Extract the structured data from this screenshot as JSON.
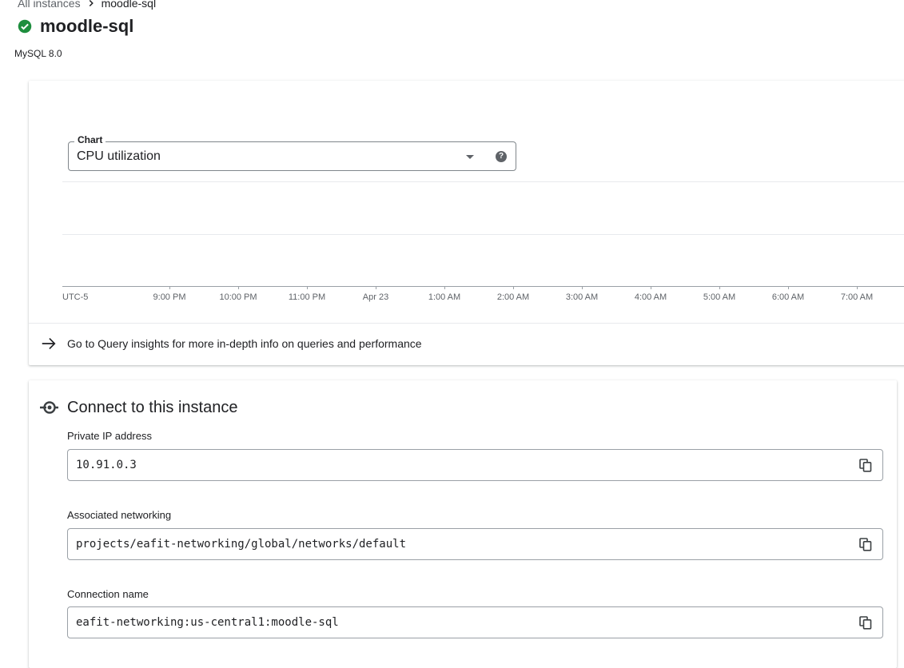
{
  "breadcrumb": {
    "root": "All instances",
    "current": "moodle-sql"
  },
  "instance": {
    "name": "moodle-sql",
    "status": "running",
    "version": "MySQL 8.0"
  },
  "chart_panel": {
    "select_legend": "Chart",
    "selected_metric": "CPU utilization",
    "timezone": "UTC-5",
    "time_ticks": [
      "9:00 PM",
      "10:00 PM",
      "11:00 PM",
      "Apr 23",
      "1:00 AM",
      "2:00 AM",
      "3:00 AM",
      "4:00 AM",
      "5:00 AM",
      "6:00 AM",
      "7:00 AM"
    ],
    "insights_link": "Go to Query insights for more in-depth info on queries and performance"
  },
  "connect": {
    "title": "Connect to this instance",
    "fields": [
      {
        "label": "Private IP address",
        "value": "10.91.0.3"
      },
      {
        "label": "Associated networking",
        "value": "projects/eafit-networking/global/networks/default"
      },
      {
        "label": "Connection name",
        "value": "eafit-networking:us-central1:moodle-sql"
      }
    ]
  },
  "colors": {
    "status_ok": "#1e8e3e",
    "icon": "#5f6368",
    "border": "#9aa0a6"
  }
}
